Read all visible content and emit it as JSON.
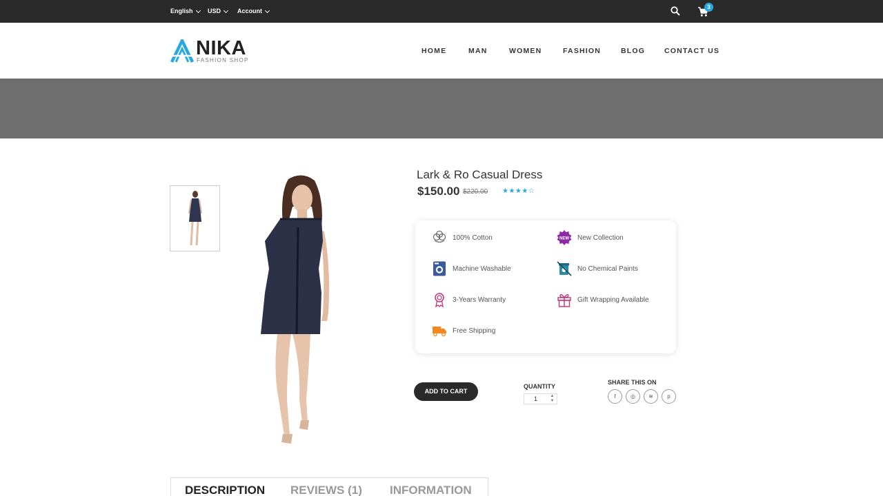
{
  "topbar": {
    "language": "English",
    "currency": "USD",
    "account": "Account",
    "cart_count": "3"
  },
  "header": {
    "logo_name": "NIKA",
    "logo_sub": "FASHION SHOP",
    "nav": [
      "HOME",
      "MAN",
      "WOMEN",
      "FASHION",
      "BLOG",
      "CONTACT US"
    ]
  },
  "product": {
    "title": "Lark & Ro Casual Dress",
    "price": "$150.00",
    "old_price": "$220.00",
    "rating": 3.5,
    "rating_max": 5,
    "stars": "★★★★☆"
  },
  "features": [
    {
      "label": "100% Cotton",
      "icon": "cotton-icon"
    },
    {
      "label": "New Collection",
      "icon": "new-badge-icon",
      "badge_text": "NEW"
    },
    {
      "label": "Machine Washable",
      "icon": "washing-machine-icon"
    },
    {
      "label": "No Chemical Paints",
      "icon": "no-chemical-icon"
    },
    {
      "label": "3-Years Warranty",
      "icon": "warranty-ribbon-icon"
    },
    {
      "label": "Gift Wrapping Available",
      "icon": "gift-icon"
    },
    {
      "label": "Free Shipping",
      "icon": "truck-icon"
    }
  ],
  "actions": {
    "add_to_cart": "ADD TO CART",
    "quantity_label": "QUANTITY",
    "quantity_value": "1",
    "share_label": "SHARE THIS ON",
    "share": [
      {
        "glyph": "f",
        "icon": "facebook-icon"
      },
      {
        "glyph": "◎",
        "icon": "instagram-icon"
      },
      {
        "glyph": "≋",
        "icon": "rss-icon"
      },
      {
        "glyph": "p",
        "icon": "pinterest-icon"
      }
    ]
  },
  "tabs": [
    "DESCRIPTION",
    "REVIEWS (1)",
    "INFORMATION"
  ],
  "colors": {
    "accent": "#29a8e0",
    "topbar": "#2a2a2a",
    "banner": "#6e6e6e",
    "button": "#2a2a2a"
  }
}
